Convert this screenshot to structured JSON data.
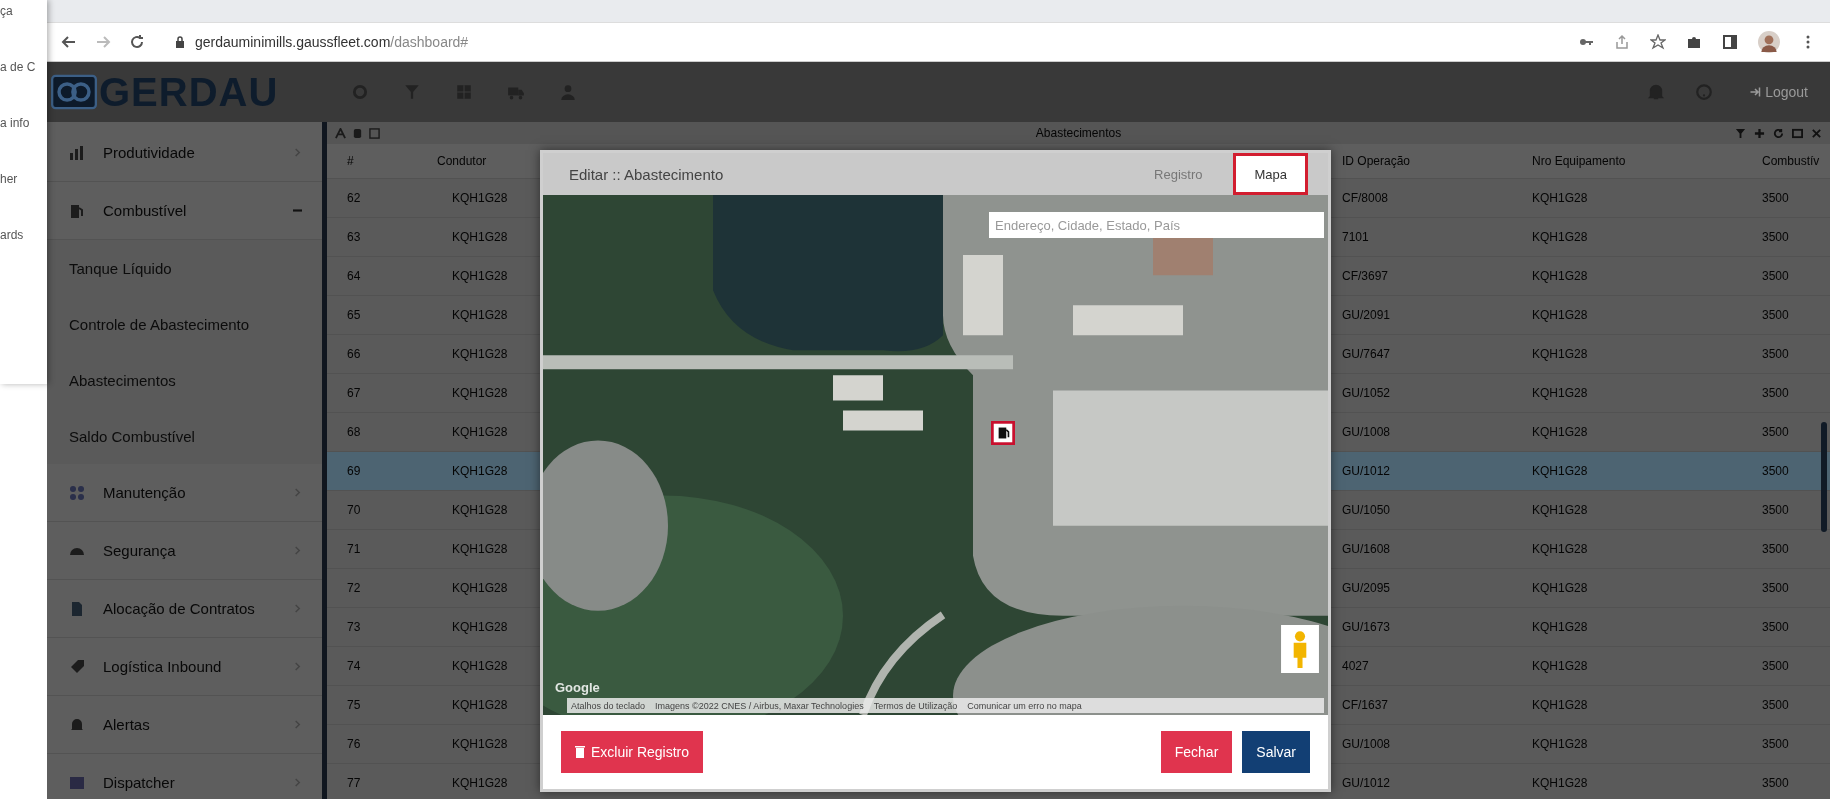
{
  "background_window": {
    "fragments": [
      "ça",
      "a de C",
      "a info",
      "her",
      "ards"
    ]
  },
  "browser": {
    "url_host": "gerdauminimills.gaussfleet.com",
    "url_path": "/dashboard#"
  },
  "app_header": {
    "logo": "GERDAU",
    "logout": "Logout"
  },
  "sidebar": {
    "items": [
      {
        "label": "Produtividade",
        "expanded": false
      },
      {
        "label": "Combustível",
        "expanded": true,
        "children": [
          {
            "label": "Tanque Líquido"
          },
          {
            "label": "Controle de Abastecimento"
          },
          {
            "label": "Abastecimentos"
          },
          {
            "label": "Saldo Combustível"
          }
        ]
      },
      {
        "label": "Manutenção",
        "expanded": false
      },
      {
        "label": "Segurança",
        "expanded": false
      },
      {
        "label": "Alocação de Contratos",
        "expanded": false
      },
      {
        "label": "Logística Inbound",
        "expanded": false
      },
      {
        "label": "Alertas",
        "expanded": false
      },
      {
        "label": "Dispatcher",
        "expanded": false
      }
    ]
  },
  "table": {
    "title": "Abastecimentos",
    "columns": [
      "#",
      "Condutor",
      "ID Operação",
      "Nro Equipamento",
      "Combustív"
    ],
    "rows": [
      {
        "cells": [
          "62",
          "KQH1G28",
          "CF/8008",
          "KQH1G28",
          "3500"
        ],
        "selected": false
      },
      {
        "cells": [
          "63",
          "KQH1G28",
          "7101",
          "KQH1G28",
          "3500"
        ],
        "selected": false
      },
      {
        "cells": [
          "64",
          "KQH1G28",
          "CF/3697",
          "KQH1G28",
          "3500"
        ],
        "selected": false
      },
      {
        "cells": [
          "65",
          "KQH1G28",
          "GU/2091",
          "KQH1G28",
          "3500"
        ],
        "selected": false
      },
      {
        "cells": [
          "66",
          "KQH1G28",
          "GU/7647",
          "KQH1G28",
          "3500"
        ],
        "selected": false
      },
      {
        "cells": [
          "67",
          "KQH1G28",
          "GU/1052",
          "KQH1G28",
          "3500"
        ],
        "selected": false
      },
      {
        "cells": [
          "68",
          "KQH1G28",
          "GU/1008",
          "KQH1G28",
          "3500"
        ],
        "selected": false
      },
      {
        "cells": [
          "69",
          "KQH1G28",
          "GU/1012",
          "KQH1G28",
          "3500"
        ],
        "selected": true
      },
      {
        "cells": [
          "70",
          "KQH1G28",
          "GU/1050",
          "KQH1G28",
          "3500"
        ],
        "selected": false
      },
      {
        "cells": [
          "71",
          "KQH1G28",
          "GU/1608",
          "KQH1G28",
          "3500"
        ],
        "selected": false
      },
      {
        "cells": [
          "72",
          "KQH1G28",
          "GU/2095",
          "KQH1G28",
          "3500"
        ],
        "selected": false
      },
      {
        "cells": [
          "73",
          "KQH1G28",
          "GU/1673",
          "KQH1G28",
          "3500"
        ],
        "selected": false
      },
      {
        "cells": [
          "74",
          "KQH1G28",
          "4027",
          "KQH1G28",
          "3500"
        ],
        "selected": false
      },
      {
        "cells": [
          "75",
          "KQH1G28",
          "CF/1637",
          "KQH1G28",
          "3500"
        ],
        "selected": false
      },
      {
        "cells": [
          "76",
          "KQH1G28",
          "GU/1008",
          "KQH1G28",
          "3500"
        ],
        "selected": false
      },
      {
        "cells": [
          "77",
          "KQH1G28",
          "GU/1012",
          "KQH1G28",
          "3500"
        ],
        "selected": false
      }
    ]
  },
  "modal": {
    "title": "Editar :: Abastecimento",
    "tabs": [
      {
        "label": "Registro",
        "selected": false
      },
      {
        "label": "Mapa",
        "selected": true
      }
    ],
    "map": {
      "search_placeholder": "Endereço, Cidade, Estado, País",
      "logo": "Google",
      "attribution": [
        "Atalhos do teclado",
        "Imagens ©2022 CNES / Airbus, Maxar Technologies",
        "Termos de Utilização",
        "Comunicar um erro no mapa"
      ]
    },
    "buttons": [
      {
        "label": "Excluir Registro",
        "kind": "delete"
      },
      {
        "label": "Fechar",
        "kind": "close"
      },
      {
        "label": "Salvar",
        "kind": "save"
      }
    ]
  }
}
